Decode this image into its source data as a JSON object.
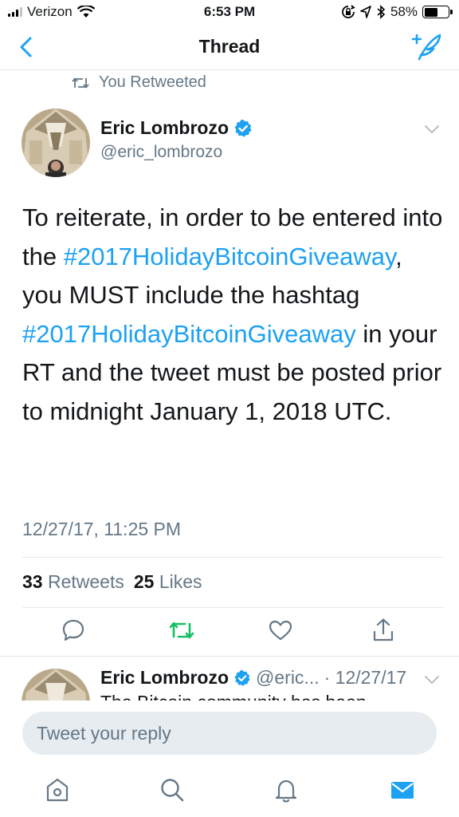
{
  "status_bar": {
    "carrier": "Verizon",
    "time": "6:53 PM",
    "battery_percent": "58%",
    "battery_level": 0.58,
    "icons": [
      "signal-icon",
      "wifi-icon",
      "lock-rotation-icon",
      "location-icon",
      "bluetooth-icon",
      "battery-icon"
    ]
  },
  "nav": {
    "title": "Thread",
    "back_icon": "chevron-left-icon",
    "compose_icon": "compose-tweet-icon"
  },
  "retweet_context": {
    "label": "You Retweeted",
    "icon": "retweet-icon"
  },
  "tweet": {
    "author_name": "Eric Lombrozo",
    "handle": "@eric_lombrozo",
    "verified": true,
    "text_part1": "To reiterate, in order to be entered into the ",
    "hashtag1": "#2017HolidayBitcoinGiveaway",
    "text_part2": ", you MUST include the hashtag ",
    "hashtag2": "#2017HolidayBitcoinGiveaway",
    "text_part3": " in your RT and the tweet must be posted prior to midnight January 1, 2018 UTC.",
    "timestamp": "12/27/17, 11:25 PM",
    "retweet_count": "33",
    "retweet_label": "Retweets",
    "like_count": "25",
    "like_label": "Likes"
  },
  "actions": [
    "reply-icon",
    "retweet-icon",
    "like-icon",
    "share-icon"
  ],
  "reply_preview": {
    "author_name": "Eric Lombrozo",
    "handle": "@eric...",
    "date": "· 12/27/17",
    "text": "The Bitcoin community has been"
  },
  "compose": {
    "placeholder": "Tweet your reply"
  },
  "tab_bar": [
    "home-icon",
    "search-icon",
    "notifications-icon",
    "messages-icon"
  ],
  "colors": {
    "accent": "#1da1f2",
    "retweeted_green": "#17bf63",
    "secondary_text": "#657786",
    "input_background": "#e6ecf0"
  }
}
